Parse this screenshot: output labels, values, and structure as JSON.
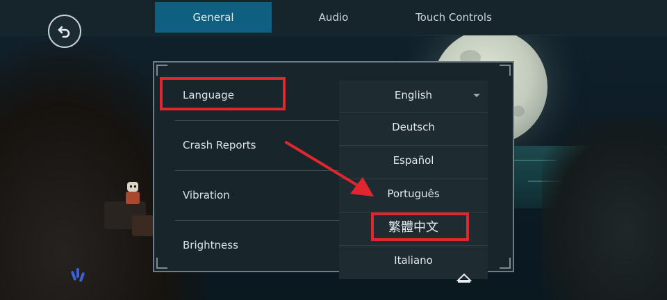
{
  "tabs": [
    {
      "label": "General",
      "active": true
    },
    {
      "label": "Audio",
      "active": false
    },
    {
      "label": "Touch Controls",
      "active": false
    }
  ],
  "back_icon": "undo-arrow-icon",
  "settings": {
    "rows": [
      {
        "label": "Language"
      },
      {
        "label": "Crash Reports"
      },
      {
        "label": "Vibration"
      },
      {
        "label": "Brightness"
      }
    ]
  },
  "language_dropdown": {
    "selected": "English",
    "options": [
      "Deutsch",
      "Español",
      "Português",
      "繁體中文",
      "Italiano"
    ],
    "expand_icon": "chevron-down-icon",
    "scroll_icon": "caret-up-icon"
  },
  "annotations": {
    "highlight_color": "#e0262f",
    "highlight_language_row": true,
    "highlight_option": "繁體中文",
    "arrow_icon": "red-arrow-icon"
  },
  "colors": {
    "active_tab": "#0e5f80",
    "panel_bg": "#18262c",
    "dropdown_bg": "#1e2b31"
  }
}
